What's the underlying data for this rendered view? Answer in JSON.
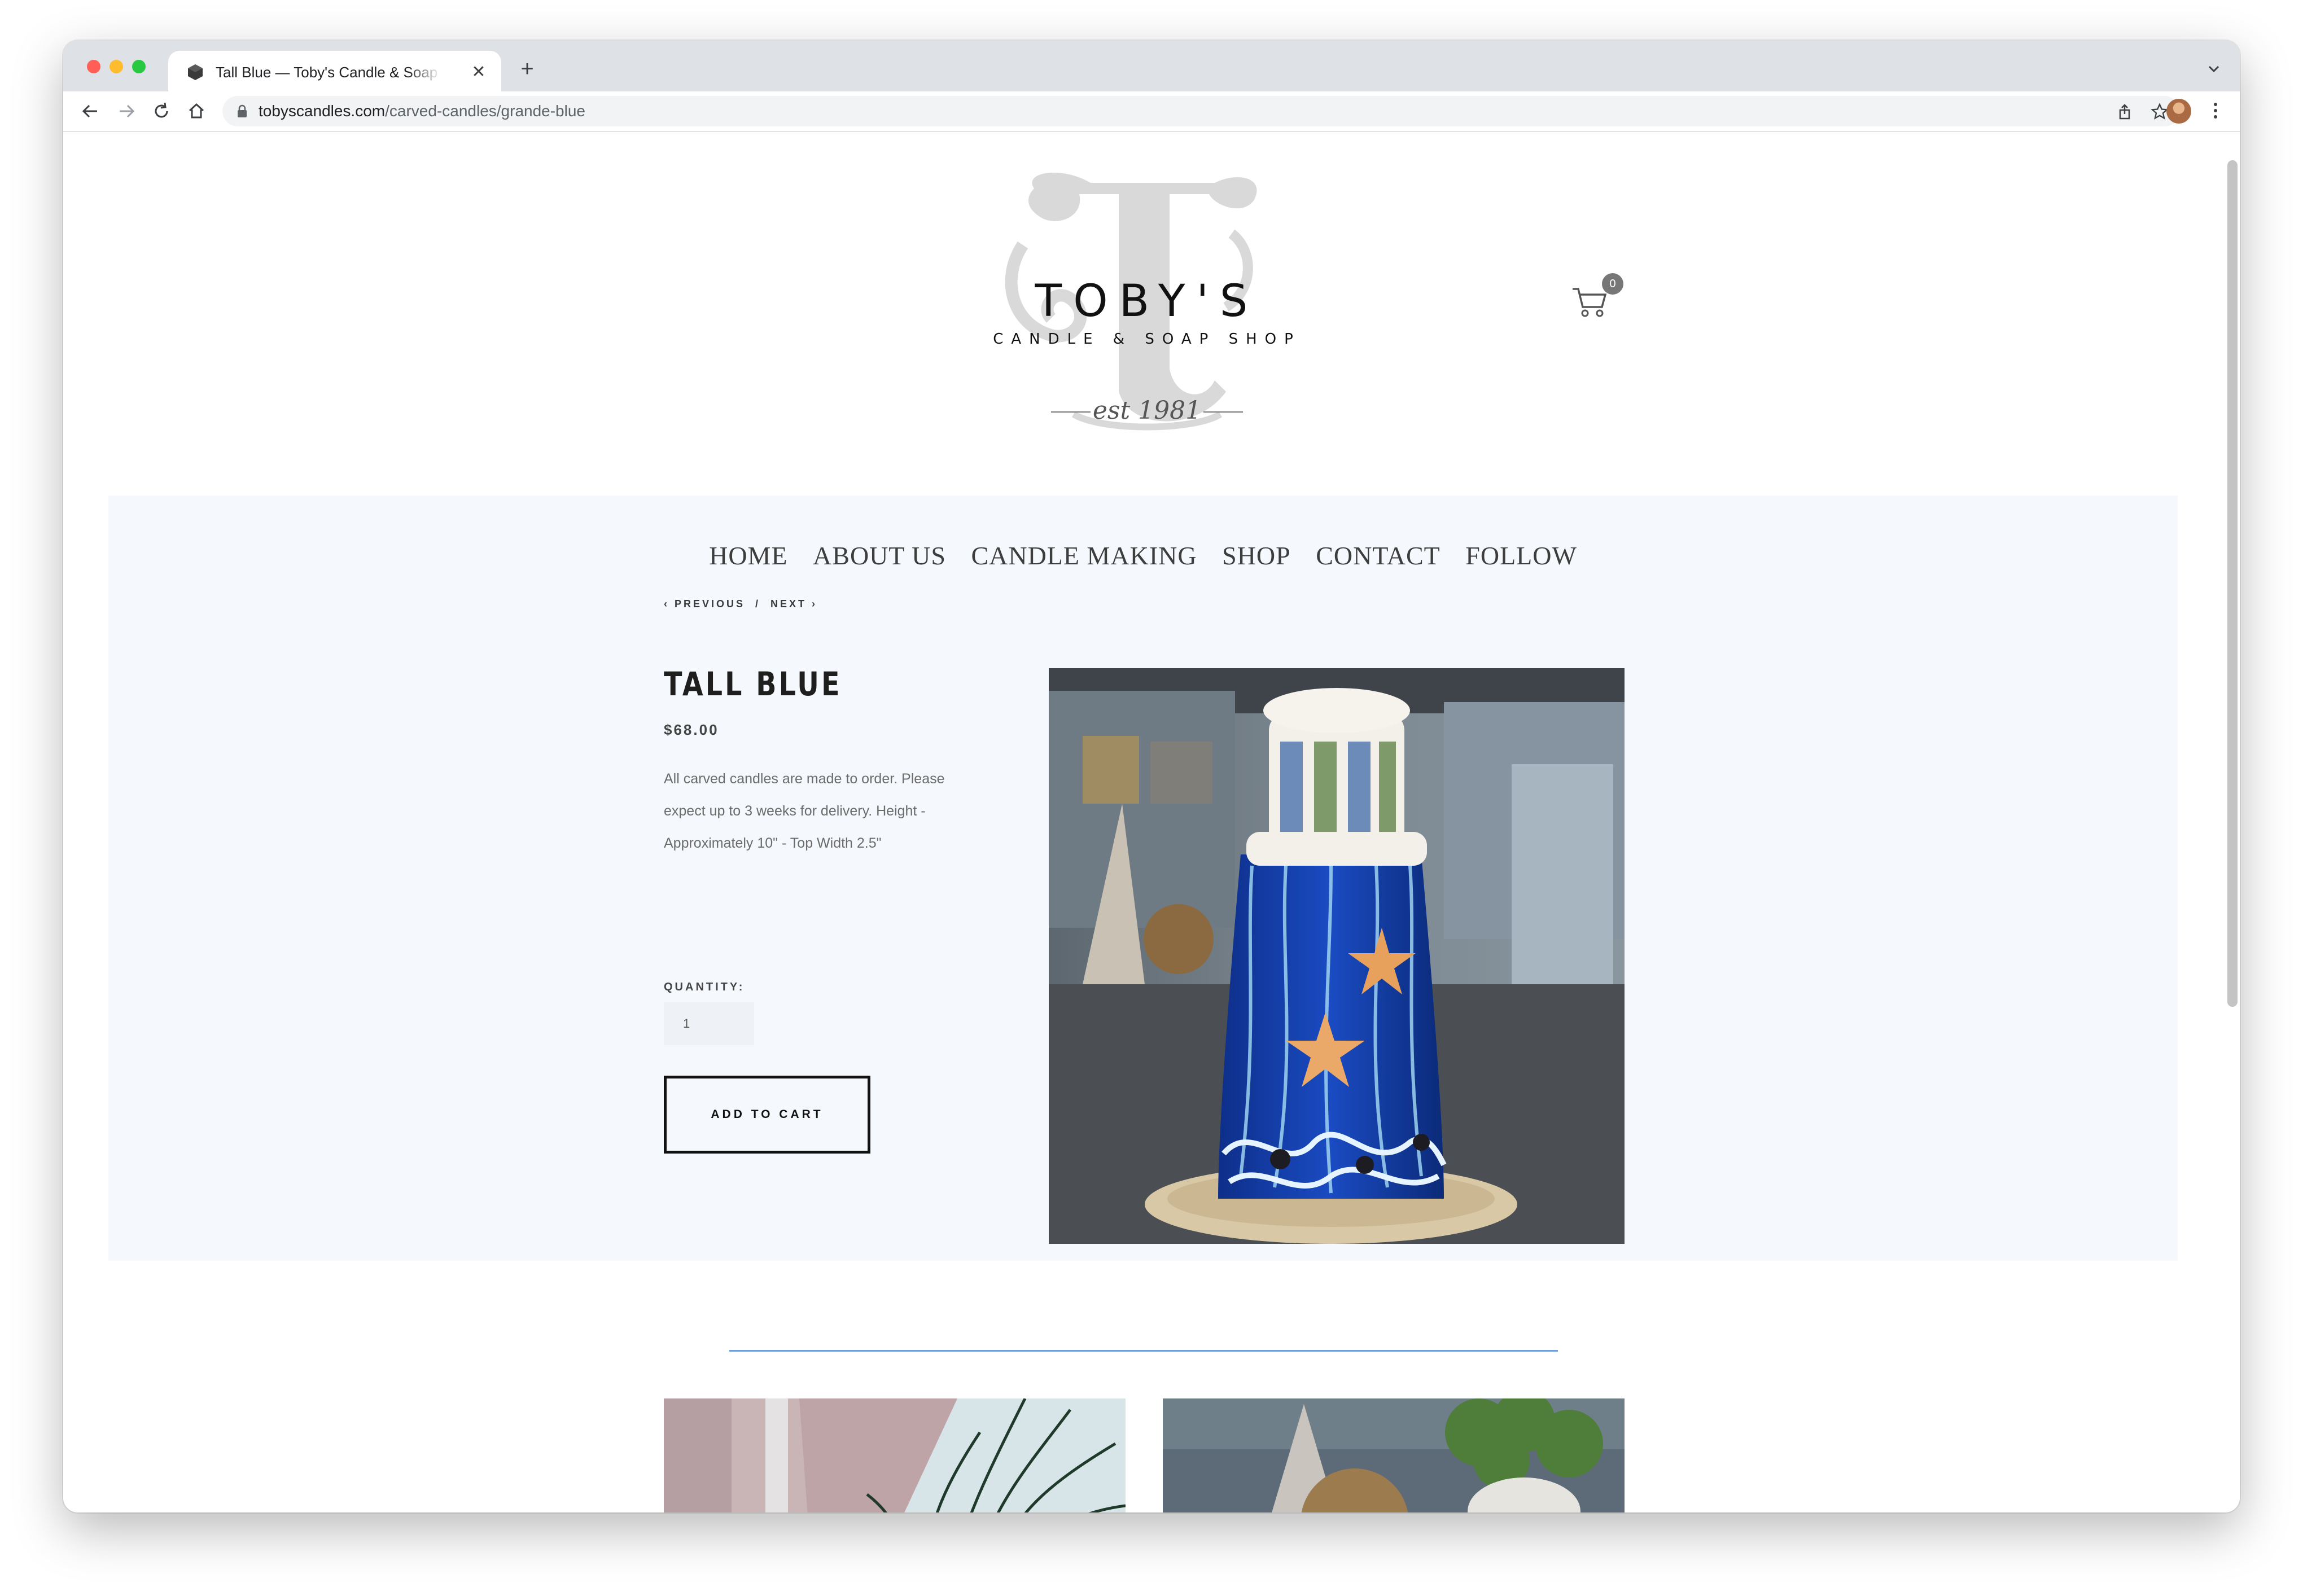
{
  "browser": {
    "tab_title": "Tall Blue — Toby's Candle & Soap Shop",
    "url_host": "tobyscandles.com",
    "url_path": "/carved-candles/grande-blue"
  },
  "site": {
    "brand": "TOBY'S",
    "tagline": "CANDLE & SOAP SHOP",
    "est": "est 1981",
    "cart_count": "0"
  },
  "nav": [
    "HOME",
    "ABOUT US",
    "CANDLE MAKING",
    "SHOP",
    "CONTACT",
    "FOLLOW"
  ],
  "pager": {
    "previous": "‹ PREVIOUS",
    "sep": "/",
    "next": "NEXT ›"
  },
  "product": {
    "title": "TALL BLUE",
    "price": "$68.00",
    "description": "All carved candles are made to order. Please expect up to 3 weeks for delivery. Height - Approximately 10\" - Top Width 2.5\"",
    "quantity_label": "QUANTITY:",
    "quantity_value": "1",
    "add_to_cart": "ADD TO CART"
  },
  "colors": {
    "panel_bg": "#f5f8fc",
    "divider": "#6f9fd8",
    "text_dark": "#1e1e1e"
  }
}
